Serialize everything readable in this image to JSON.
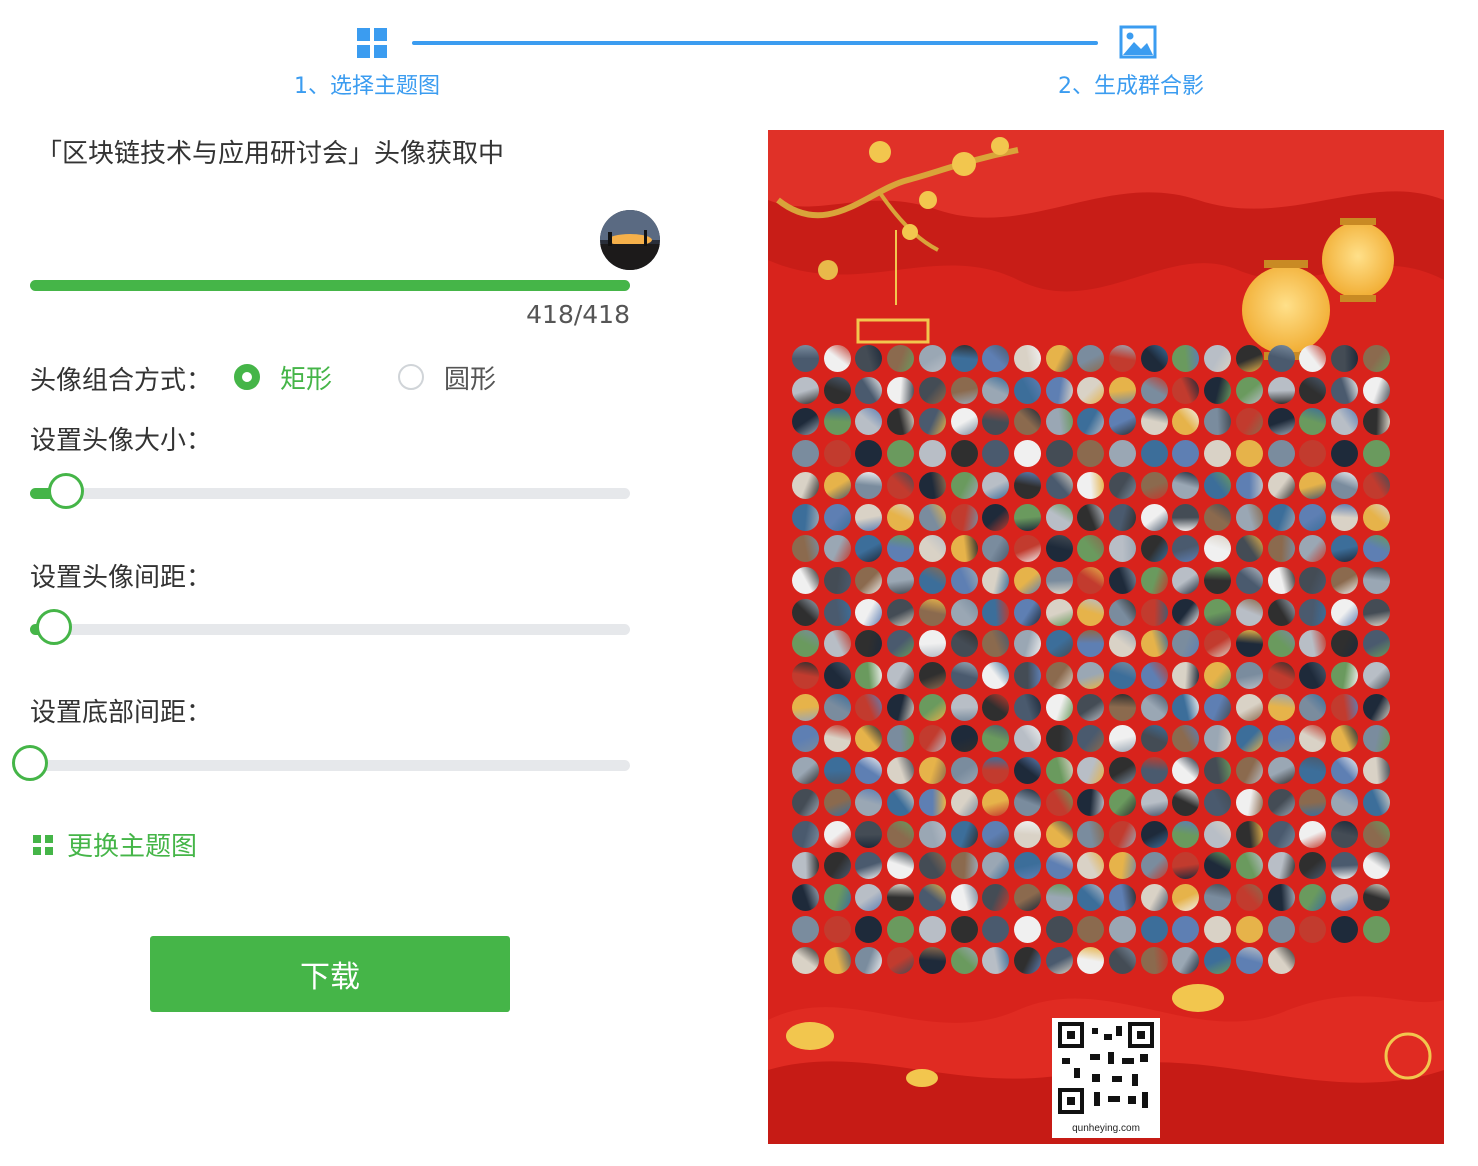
{
  "steps": [
    {
      "label": "1、选择主题图",
      "icon": "grid-icon"
    },
    {
      "label": "2、生成群合影",
      "icon": "image-icon"
    }
  ],
  "panel": {
    "title": "「区块链技术与应用研讨会」头像获取中",
    "progress": {
      "current": 418,
      "total": 418,
      "text": "418/418",
      "fraction": 1.0
    },
    "combine_label": "头像组合方式：",
    "combine_options": [
      {
        "label": "矩形",
        "checked": true
      },
      {
        "label": "圆形",
        "checked": false
      }
    ],
    "size_label": "设置头像大小：",
    "size_level": 0.06,
    "gap_label": "设置头像间距：",
    "gap_level": 0.04,
    "bottom_label": "设置底部间距：",
    "bottom_level": 0.0,
    "change_theme": "更换主题图",
    "download": "下载"
  },
  "poster": {
    "qr_caption": "qunheying.com"
  },
  "colors": {
    "accent_blue": "#3b9cf0",
    "accent_green": "#45b548",
    "poster_red": "#d8231c"
  }
}
